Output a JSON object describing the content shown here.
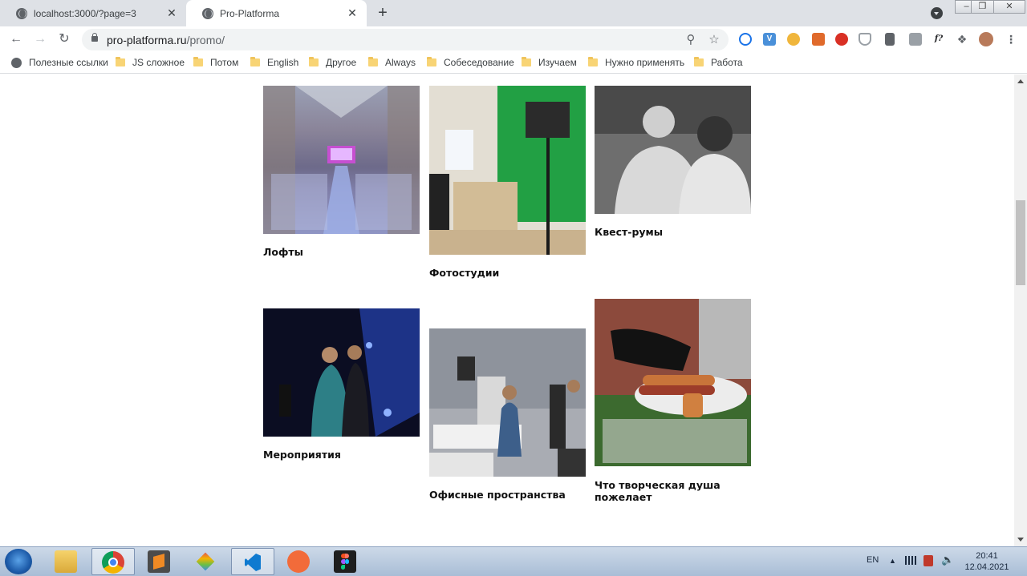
{
  "browser": {
    "tabs": [
      {
        "title": "localhost:3000/?page=3",
        "active": false
      },
      {
        "title": "Pro-Platforma",
        "active": true
      }
    ],
    "new_tab_glyph": "+",
    "tab_close_glyph": "✕",
    "url": {
      "host": "pro-platforma.ru",
      "path": "/promo/"
    },
    "extensions": [
      "chrome-web-store-icon",
      "vk-icon",
      "emoji-icon",
      "off-badge-icon",
      "adblock-icon",
      "shield-icon",
      "eyedropper-icon",
      "off-badge-icon",
      "fx-icon",
      "puzzle-icon",
      "profile-avatar"
    ],
    "extension_labels": {
      "fx": "f?"
    }
  },
  "bookmarks": [
    {
      "label": "Полезные ссылки",
      "icon": "globe-icon"
    },
    {
      "label": "JS сложное",
      "icon": "folder-icon"
    },
    {
      "label": "Потом",
      "icon": "folder-icon"
    },
    {
      "label": "English",
      "icon": "folder-icon"
    },
    {
      "label": "Другое",
      "icon": "folder-icon"
    },
    {
      "label": "Always",
      "icon": "folder-icon"
    },
    {
      "label": "Собеседование",
      "icon": "folder-icon"
    },
    {
      "label": "Изучаем",
      "icon": "folder-icon"
    },
    {
      "label": "Нужно применять",
      "icon": "folder-icon"
    },
    {
      "label": "Работа",
      "icon": "folder-icon"
    }
  ],
  "page": {
    "cards": [
      {
        "caption": "Лофты",
        "photo": "loft-hall-with-chairs"
      },
      {
        "caption": "Фотостудии",
        "photo": "photo-studio-green-screen"
      },
      {
        "caption": "Квест-румы",
        "photo": "black-and-white-people-talking"
      },
      {
        "caption": "Мероприятия",
        "photo": "stage-performers-blue-lights"
      },
      {
        "caption": "Офисные пространства",
        "photo": "office-space-with-camera"
      },
      {
        "caption": "Что творческая душа пожелает",
        "photo": "catering-hot-dogs"
      }
    ]
  },
  "taskbar": {
    "apps": [
      "windows-explorer",
      "google-chrome",
      "sublime-text",
      "sourcetree",
      "visual-studio-code",
      "postman",
      "figma"
    ],
    "language": "EN",
    "time": "20:41",
    "date": "12.04.2021"
  }
}
